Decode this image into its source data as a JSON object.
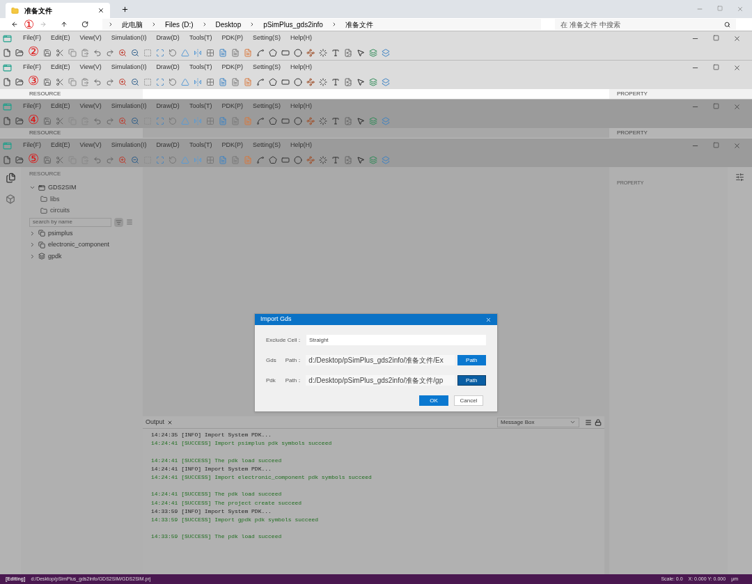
{
  "explorer": {
    "tab": {
      "label": "准备文件",
      "selected": true
    },
    "breadcrumb": [
      "此电脑",
      "Files (D:)",
      "Desktop",
      "pSimPlus_gds2info",
      "准备文件"
    ],
    "search": {
      "placeholder": "在 准备文件 中搜索"
    },
    "annotation": "①"
  },
  "windows": [
    {
      "annotation": "②",
      "dimmed": false,
      "menu": [
        "File(F)",
        "Edit(E)",
        "View(V)",
        "Simulation(I)",
        "Draw(D)",
        "Tools(T)",
        "PDK(P)",
        "Setting(S)",
        "Help(H)"
      ]
    },
    {
      "annotation": "③",
      "dimmed": false,
      "menu": [
        "File(F)",
        "Edit(E)",
        "View(V)",
        "Simulation(I)",
        "Draw(D)",
        "Tools(T)",
        "PDK(P)",
        "Setting(S)",
        "Help(H)"
      ],
      "strip": {
        "left": "RESOURCE",
        "right": "PROPERTY"
      }
    },
    {
      "annotation": "④",
      "dimmed": true,
      "menu": [
        "File(F)",
        "Edit(E)",
        "View(V)",
        "Simulation(I)",
        "Draw(D)",
        "Tools(T)",
        "PDK(P)",
        "Setting(S)",
        "Help(H)"
      ],
      "strip": {
        "left": "RESOURCE",
        "right": "PROPERTY"
      }
    },
    {
      "annotation": "⑤",
      "dimmed": true,
      "menu": [
        "File(F)",
        "Edit(E)",
        "View(V)",
        "Simulation(I)",
        "Draw(D)",
        "Tools(T)",
        "PDK(P)",
        "Setting(S)",
        "Help(H)"
      ]
    }
  ],
  "resource": {
    "title": "RESOURCE",
    "project": {
      "label": "GDS2SIM",
      "expanded": true,
      "children": [
        {
          "label": "libs"
        },
        {
          "label": "circuits"
        }
      ]
    },
    "search": {
      "placeholder": "search by name"
    },
    "libraries": [
      {
        "label": "psimplus",
        "kind": "library",
        "expanded": false
      },
      {
        "label": "electronic_component",
        "kind": "library",
        "expanded": false
      },
      {
        "label": "gpdk",
        "kind": "pdk",
        "expanded": false
      }
    ]
  },
  "property": {
    "title": "PROPERTY"
  },
  "dialog": {
    "title": "Import Gds",
    "rows": [
      {
        "kind": "input",
        "label": "Exclude Cell：",
        "value": "Straight"
      },
      {
        "kind": "path",
        "label": "Gds",
        "sublabel": "Path：",
        "value": "d:/Desktop/pSimPlus_gds2info/准备文件/Ex",
        "button": "Path",
        "focused": false
      },
      {
        "kind": "path",
        "label": "Pdk",
        "sublabel": "Path：",
        "value": "d:/Desktop/pSimPlus_gds2info/准备文件/gp",
        "button": "Path",
        "focused": true
      }
    ],
    "buttons": [
      {
        "label": "OK",
        "kind": "primary"
      },
      {
        "label": "Cancel",
        "kind": "secondary"
      }
    ]
  },
  "output": {
    "tab": "Output",
    "filter": "Message Box",
    "lines": [
      {
        "kind": "info",
        "text": "14:24:35 [INFO] Import System PDK..."
      },
      {
        "kind": "success",
        "text": "14:24:41 [SUCCESS] Import psimplus pdk symbols succeed"
      },
      {
        "kind": "blank"
      },
      {
        "kind": "success",
        "text": "14:24:41 [SUCCESS] The pdk load succeed"
      },
      {
        "kind": "info",
        "text": "14:24:41 [INFO] Import System PDK..."
      },
      {
        "kind": "success",
        "text": "14:24:41 [SUCCESS] Import electronic_component pdk symbols succeed"
      },
      {
        "kind": "blank"
      },
      {
        "kind": "success",
        "text": "14:24:41 [SUCCESS] The pdk load succeed"
      },
      {
        "kind": "success",
        "text": "14:24:41 [SUCCESS] The project create succeed"
      },
      {
        "kind": "info",
        "text": "14:33:59 [INFO] Import System PDK..."
      },
      {
        "kind": "success",
        "text": "14:33:59 [SUCCESS] Import gpdk pdk symbols succeed"
      },
      {
        "kind": "blank"
      },
      {
        "kind": "success",
        "text": "14:33:59 [SUCCESS] The pdk load succeed"
      }
    ]
  },
  "status_bar": {
    "mode": "[Editing]",
    "path": "d:/Desktop/pSimPlus_gds2info/GDS2SIM/GDS2SIM.prj",
    "scale": "Scale: 0.0",
    "coords": "X: 0.000 Y: 0.000",
    "unit": "μm"
  }
}
